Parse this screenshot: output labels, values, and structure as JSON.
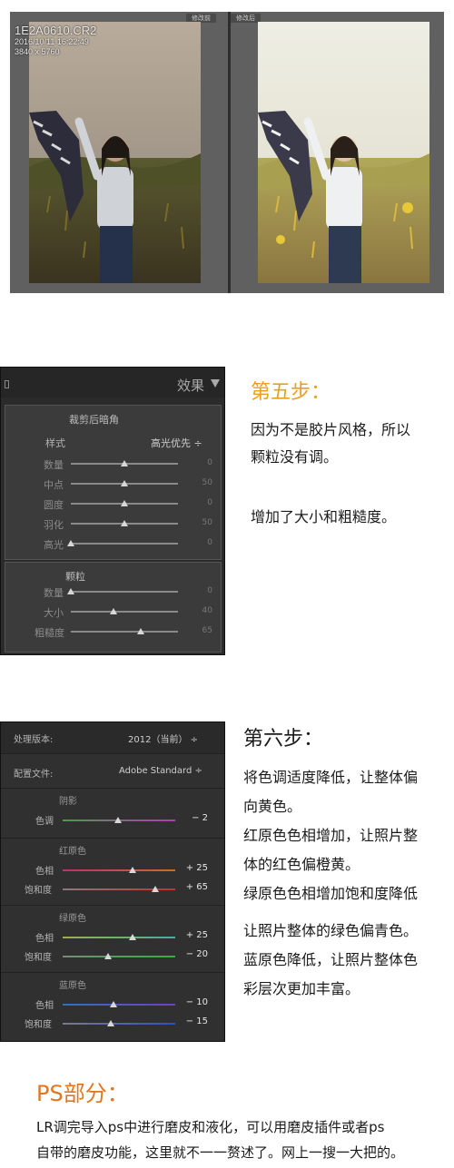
{
  "compare": {
    "before_label": "修改前",
    "after_label": "修改后",
    "file_name": "1E2A0610.CR2",
    "date": "2016/10/11 16:22:49",
    "dimensions": "3840 x 5760"
  },
  "effects_panel": {
    "title": "效果",
    "vignette": {
      "title": "裁剪后暗角",
      "style_label": "样式",
      "style_value": "高光优先",
      "sliders": [
        {
          "label": "数量",
          "value": "0",
          "level": 0.5
        },
        {
          "label": "中点",
          "value": "50",
          "level": 0.5
        },
        {
          "label": "圆度",
          "value": "0",
          "level": 0.5
        },
        {
          "label": "羽化",
          "value": "50",
          "level": 0.5
        },
        {
          "label": "高光",
          "value": "0",
          "level": 0.0
        }
      ]
    },
    "grain": {
      "title": "颗粒",
      "sliders": [
        {
          "label": "数量",
          "value": "0",
          "level": 0.0
        },
        {
          "label": "大小",
          "value": "40",
          "level": 0.4
        },
        {
          "label": "粗糙度",
          "value": "65",
          "level": 0.65
        }
      ]
    }
  },
  "step5": {
    "title": "第五步：",
    "lines": [
      "因为不是胶片风格，所以",
      "颗粒没有调。",
      "增加了大小和粗糙度。"
    ]
  },
  "calibration_panel": {
    "process_label": "处理版本:",
    "process_value": "2012（当前）",
    "profile_label": "配置文件:",
    "profile_value": "Adobe Standard",
    "shadows": {
      "title": "阴影",
      "sliders": [
        {
          "label": "色调",
          "value": "− 2",
          "level": 0.49,
          "gradient": [
            "#4d9a4d",
            "#b03cb0"
          ]
        }
      ]
    },
    "red": {
      "title": "红原色",
      "sliders": [
        {
          "label": "色相",
          "value": "+ 25",
          "level": 0.62,
          "gradient": [
            "#c0306a",
            "#c07030"
          ]
        },
        {
          "label": "饱和度",
          "value": "+ 65",
          "level": 0.82,
          "gradient": [
            "#8a7a7a",
            "#c03030"
          ]
        }
      ]
    },
    "green": {
      "title": "绿原色",
      "sliders": [
        {
          "label": "色相",
          "value": "+ 25",
          "level": 0.62,
          "gradient": [
            "#a0b040",
            "#40b0a0"
          ]
        },
        {
          "label": "饱和度",
          "value": "− 20",
          "level": 0.4,
          "gradient": [
            "#7a8a7a",
            "#30b040"
          ]
        }
      ]
    },
    "blue": {
      "title": "蓝原色",
      "sliders": [
        {
          "label": "色相",
          "value": "− 10",
          "level": 0.45,
          "gradient": [
            "#3070c0",
            "#7040c0"
          ]
        },
        {
          "label": "饱和度",
          "value": "− 15",
          "level": 0.43,
          "gradient": [
            "#7a7a8a",
            "#3050c0"
          ]
        }
      ]
    }
  },
  "step6": {
    "title": "第六步：",
    "lines": [
      "将色调适度降低，让整体偏",
      "向黄色。",
      "红原色色相增加，让照片整",
      "体的红色偏橙黄。",
      "绿原色色相增加饱和度降低",
      "让照片整体的绿色偏青色。",
      "蓝原色降低，让照片整体色",
      "彩层次更加丰富。"
    ]
  },
  "ps": {
    "title": "PS部分：",
    "lines": [
      "LR调完导入ps中进行磨皮和液化，可以用磨皮插件或者ps",
      "自带的磨皮功能，这里就不一一赘述了。网上一搜一大把的。"
    ]
  },
  "colors": {
    "title_orange": "#e8a020",
    "ps_title": "#e2761e",
    "panel_bg": "#3b3b3b"
  }
}
